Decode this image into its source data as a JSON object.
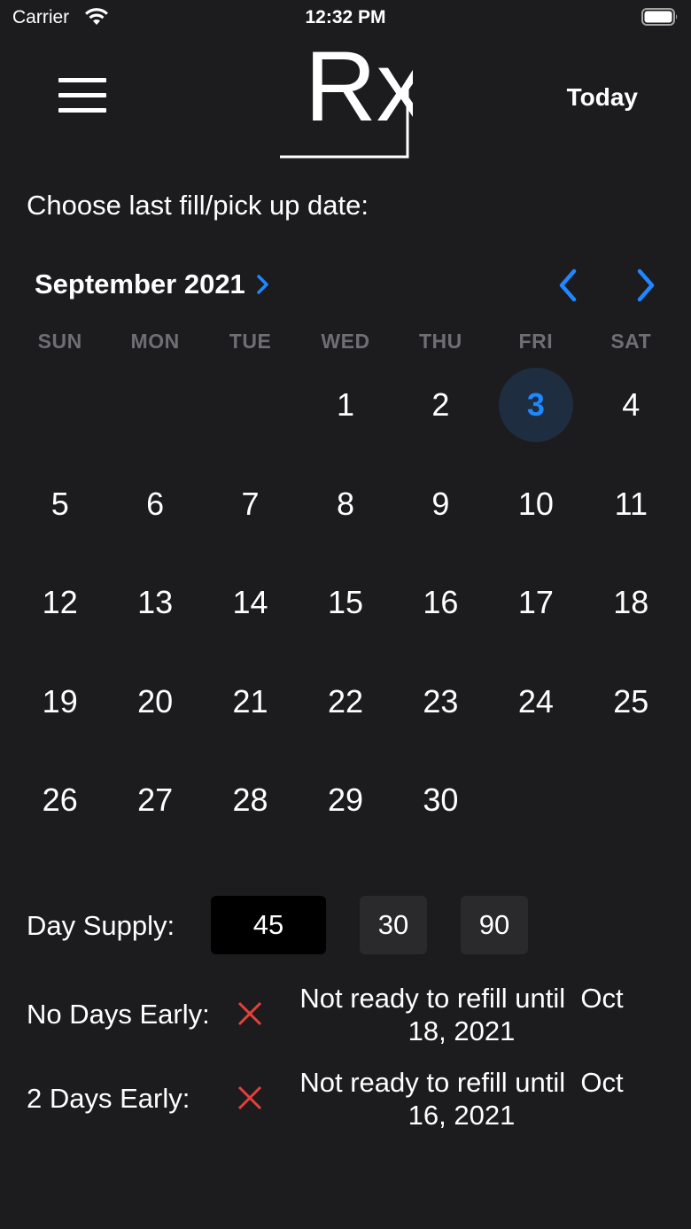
{
  "status_bar": {
    "carrier": "Carrier",
    "time": "12:32 PM"
  },
  "header": {
    "menu_icon": "hamburger-menu-icon",
    "logo_text": "Rx",
    "today_label": "Today"
  },
  "prompt": "Choose last fill/pick up date:",
  "calendar": {
    "month_label": "September 2021",
    "weekdays": [
      "SUN",
      "MON",
      "TUE",
      "WED",
      "THU",
      "FRI",
      "SAT"
    ],
    "first_weekday_index": 3,
    "days_in_month": 30,
    "selected_day": 3,
    "accent_color": "#1f88ff"
  },
  "day_supply": {
    "label": "Day Supply:",
    "selected": "45",
    "options": [
      "30",
      "90"
    ]
  },
  "results": [
    {
      "label": "No Days Early:",
      "status_icon": "x-mark-icon",
      "message_line1": "Not ready to refill until  Oct",
      "message_line2": "18, 2021"
    },
    {
      "label": "2 Days Early:",
      "status_icon": "x-mark-icon",
      "message_line1": "Not ready to refill until  Oct",
      "message_line2": "16, 2021"
    }
  ],
  "colors": {
    "background": "#1c1c1e",
    "accent": "#1f88ff",
    "error": "#e5403a",
    "selected_day_bg": "#1e2d40"
  }
}
